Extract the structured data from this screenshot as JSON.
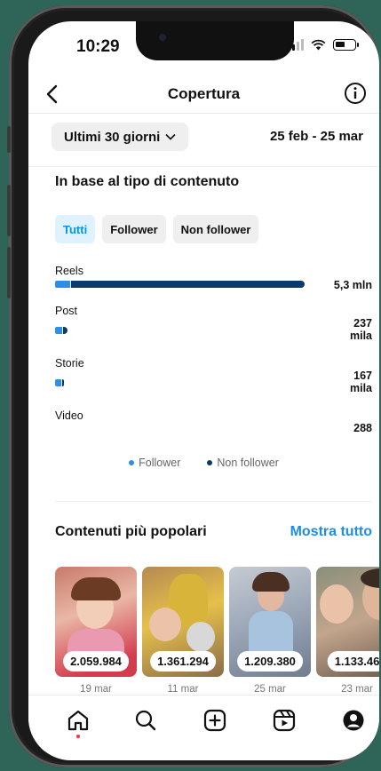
{
  "status_bar": {
    "time": "10:29"
  },
  "header": {
    "title": "Copertura"
  },
  "filter": {
    "range_label": "Ultimi 30 giorni",
    "date_range": "25 feb - 25 mar"
  },
  "content_type": {
    "title": "In base al tipo di contenuto",
    "tabs": [
      "Tutti",
      "Follower",
      "Non follower"
    ],
    "active_tab": "Tutti",
    "metrics": [
      {
        "label": "Reels",
        "value": "5,3 mln",
        "follower_fraction": 0.06,
        "total_fraction": 1.0
      },
      {
        "label": "Post",
        "value_line1": "237",
        "value_line2": "mila",
        "follower_fraction": 0.6,
        "total_fraction": 0.045
      },
      {
        "label": "Storie",
        "value_line1": "167",
        "value_line2": "mila",
        "follower_fraction": 0.8,
        "total_fraction": 0.032
      },
      {
        "label": "Video",
        "value": "288",
        "follower_fraction": 0,
        "total_fraction": 0
      }
    ],
    "legend": [
      "Follower",
      "Non follower"
    ],
    "colors": {
      "follower": "#2e8fe8",
      "non_follower": "#0b3a6e"
    }
  },
  "popular": {
    "title": "Contenuti più popolari",
    "show_all": "Mostra tutto",
    "items": [
      {
        "count": "2.059.984",
        "date": "19 mar"
      },
      {
        "count": "1.361.294",
        "date": "11 mar"
      },
      {
        "count": "1.209.380",
        "date": "25 mar"
      },
      {
        "count": "1.133.46",
        "date": "23 mar"
      }
    ]
  },
  "nav": [
    "home-icon",
    "search-icon",
    "create-icon",
    "reels-icon",
    "profile-icon"
  ]
}
